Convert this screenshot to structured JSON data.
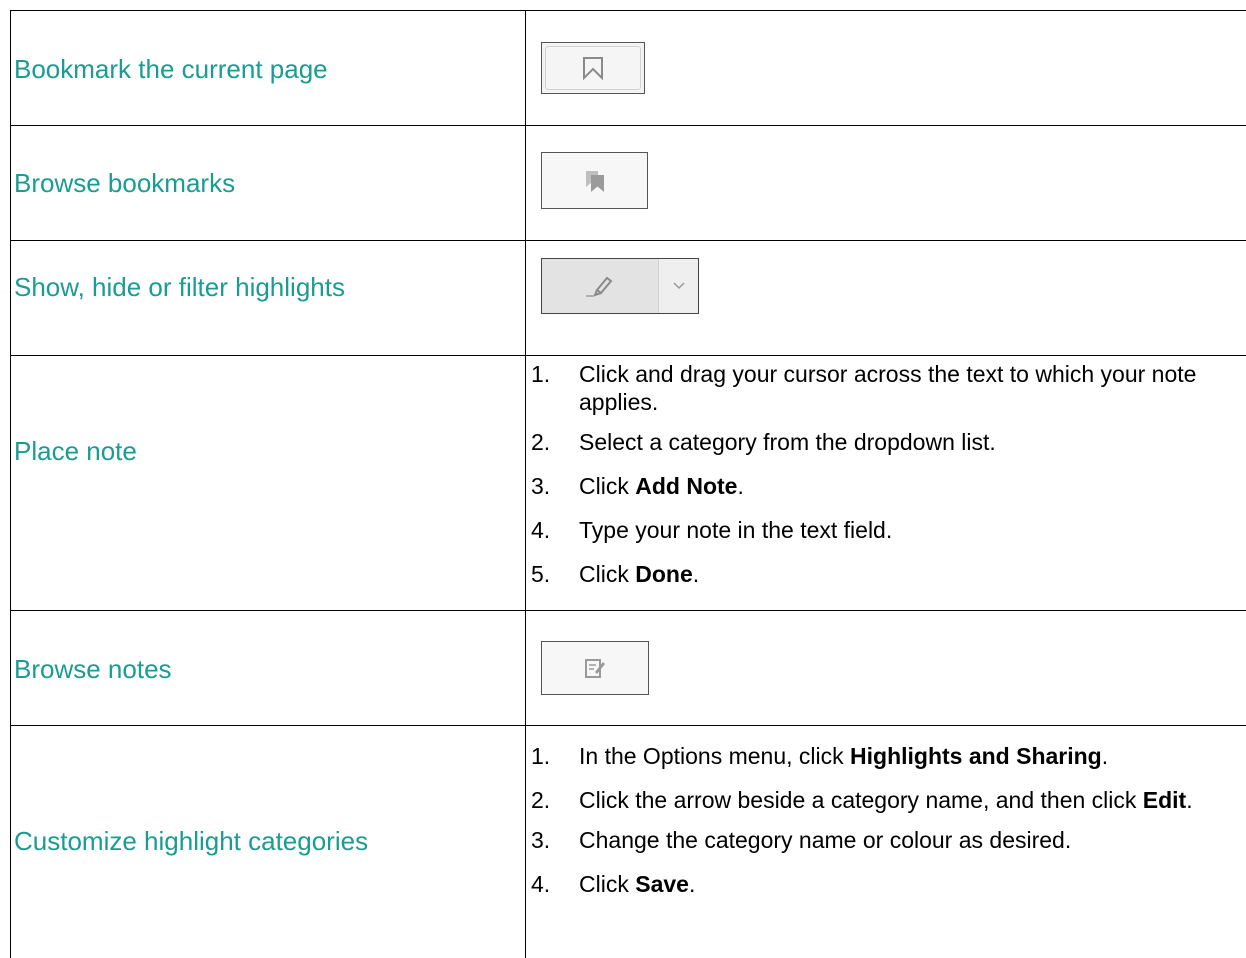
{
  "colors": {
    "label": "#1a9c93",
    "border": "#000000"
  },
  "rows": [
    {
      "label": "Bookmark the current page",
      "icon": "bookmark-outline-icon"
    },
    {
      "label": "Browse bookmarks",
      "icon": "bookmarks-stack-icon"
    },
    {
      "label": "Show, hide or filter highlights",
      "icon": "highlighter-icon",
      "dropdown_icon": "chevron-down-icon"
    },
    {
      "label": "Place note",
      "steps": [
        {
          "num": "1.",
          "text": "Click and drag your cursor across the text to which your note applies."
        },
        {
          "num": "2.",
          "text": "Select a category from the dropdown list."
        },
        {
          "num": "3.",
          "pre": "Click ",
          "bold": "Add Note",
          "post": "."
        },
        {
          "num": "4.",
          "text": "Type your note in the text field."
        },
        {
          "num": "5.",
          "pre": "Click ",
          "bold": "Done",
          "post": "."
        }
      ]
    },
    {
      "label": "Browse notes",
      "icon": "notes-edit-icon"
    },
    {
      "label": "Customize highlight categories",
      "steps": [
        {
          "num": "1.",
          "pre": "In the Options menu, click ",
          "bold": "Highlights and Sharing",
          "post": "."
        },
        {
          "num": "2.",
          "pre": "Click the arrow beside a category name, and then click ",
          "bold": "Edit",
          "post": "."
        },
        {
          "num": "3.",
          "text": "Change the category name or colour as desired."
        },
        {
          "num": "4.",
          "pre": "Click ",
          "bold": "Save",
          "post": "."
        }
      ]
    }
  ]
}
